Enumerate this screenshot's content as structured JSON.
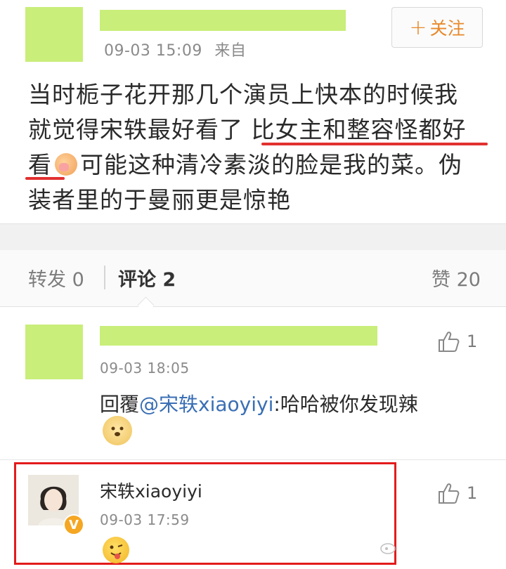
{
  "post": {
    "timestamp": "09-03 15:09",
    "source": "来自",
    "follow_label": "关注",
    "follow_plus": "+",
    "text_line1": "当时栀子花开那几个演员上快本的时候我",
    "text_line2a": "就觉得宋轶最好看了 ",
    "text_line2b": "比女主和整容怪都好",
    "text_line3a": "看",
    "text_line3b": "可能这种清冷素淡的脸是我的菜。伪",
    "text_line4": "装者里的于曼丽更是惊艳",
    "emoji_icon": "shush-emoji-icon"
  },
  "tabs": {
    "repost": "转发 0",
    "comments": "评论 2",
    "likes": "赞 20"
  },
  "comments": [
    {
      "time": "09-03 18:05",
      "reply_prefix": "回覆",
      "mention": "@宋轶xiaoyiyi",
      "reply_text": ":哈哈被你发现辣",
      "likes": "1",
      "emoji": "doge-emoji-icon"
    },
    {
      "name": "宋轶xiaoyiyi",
      "time": "09-03 17:59",
      "likes": "1",
      "badge": "V",
      "emoji": "tongue-emoji-icon"
    }
  ],
  "colors": {
    "accent": "#e8892b",
    "mention": "#3a6fb5",
    "highlight": "#e31b1b",
    "redaction": "#c9ee7a"
  }
}
